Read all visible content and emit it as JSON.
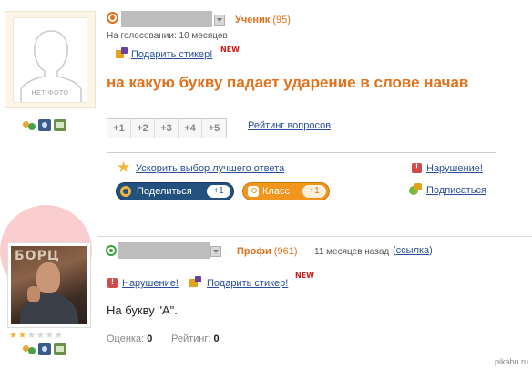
{
  "question": {
    "avatar": {
      "placeholder_text": "НЕТ ФОТО"
    },
    "author": {
      "rank": "Ученик",
      "score": "(95)",
      "voting_status": "На голосовании: 10 месяцев"
    },
    "sticker_link": "Подарить стикер!",
    "sticker_badge": "NEW",
    "title": "на какую букву падает ударение в слове начав",
    "rating_buttons": [
      "+1",
      "+2",
      "+3",
      "+4",
      "+5"
    ],
    "rating_link": "Рейтинг вопросов",
    "actions": {
      "speed_up": "Ускорить выбор лучшего ответа",
      "violation": "Нарушение!",
      "subscribe": "Подписаться",
      "share_label": "Поделиться",
      "share_count": "+1",
      "ok_label": "Класс",
      "ok_count": "+1"
    },
    "icons": [
      "people-icon",
      "camera-icon",
      "video-icon"
    ]
  },
  "answer": {
    "avatar": {
      "wall_text": "БОРЦ"
    },
    "stars": {
      "filled": 2,
      "total": 6
    },
    "author": {
      "rank": "Профи",
      "score": "(961)",
      "time": "11 месяцев назад",
      "link_open": "(",
      "link_text": "ссылка",
      "link_close": ")"
    },
    "violation": "Нарушение!",
    "sticker_link": "Подарить стикер!",
    "sticker_badge": "NEW",
    "text": "На букву \"А\".",
    "rating_label": "Оценка:",
    "rating_value": "0",
    "reputation_label": "Рейтинг:",
    "reputation_value": "0",
    "icons": [
      "people-icon",
      "camera-icon",
      "video-icon"
    ]
  },
  "watermark": "pikabu.ru",
  "colors": {
    "accent_orange": "#e3701b",
    "link_blue": "#2b4f9c",
    "share_blue": "#23517e",
    "ok_orange": "#f0961e",
    "highlight_red": "#ee6868"
  }
}
